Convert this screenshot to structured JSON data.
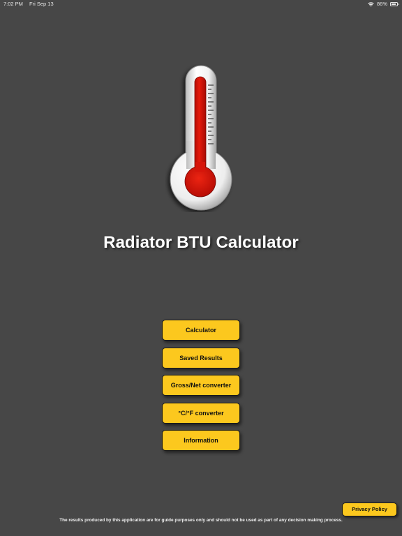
{
  "status_bar": {
    "time": "7:02 PM",
    "date": "Fri Sep 13",
    "battery": "86%",
    "battery_level": 0.86,
    "wifi_icon": "wifi-icon",
    "battery_icon": "battery-icon"
  },
  "app": {
    "title": "Radiator BTU Calculator",
    "logo_icon": "thermometer-icon"
  },
  "menu": {
    "items": [
      {
        "label": "Calculator"
      },
      {
        "label": "Saved Results"
      },
      {
        "label": "Gross/Net converter"
      },
      {
        "label": "°C/°F converter"
      },
      {
        "label": "Information"
      }
    ]
  },
  "footer": {
    "privacy_label": "Privacy Policy",
    "disclaimer": "The results produced by this application are for guide purposes only and should not be used as part of any decision making process."
  },
  "colors": {
    "background": "#474747",
    "button": "#fcc81e",
    "mercury": "#e0140a"
  }
}
